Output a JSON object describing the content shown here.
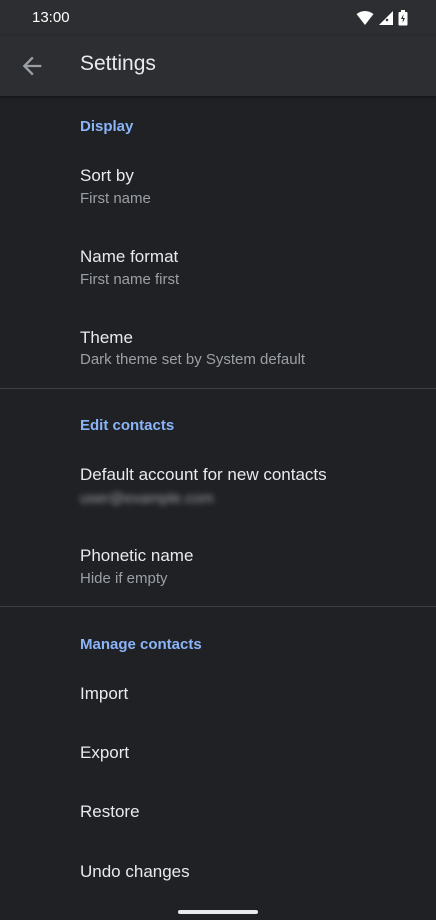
{
  "status_bar": {
    "time": "13:00"
  },
  "app_bar": {
    "title": "Settings"
  },
  "sections": [
    {
      "header": "Display",
      "items": [
        {
          "title": "Sort by",
          "subtitle": "First name"
        },
        {
          "title": "Name format",
          "subtitle": "First name first"
        },
        {
          "title": "Theme",
          "subtitle": "Dark theme set by System default"
        }
      ]
    },
    {
      "header": "Edit contacts",
      "items": [
        {
          "title": "Default account for new contacts",
          "subtitle": "user@example.com"
        },
        {
          "title": "Phonetic name",
          "subtitle": "Hide if empty"
        }
      ]
    },
    {
      "header": "Manage contacts",
      "items": [
        {
          "title": "Import"
        },
        {
          "title": "Export"
        },
        {
          "title": "Restore"
        },
        {
          "title": "Undo changes"
        }
      ]
    }
  ],
  "icons": {
    "back": "arrow-back-icon",
    "wifi": "wifi-icon",
    "signal": "cell-signal-icon",
    "battery": "battery-charging-icon"
  },
  "colors": {
    "background": "#202124",
    "app_bar": "#2d2e31",
    "accent": "#8ab4f8",
    "primary_text": "#e8eaed",
    "secondary_text": "#9aa0a6",
    "divider": "#3c4043"
  }
}
